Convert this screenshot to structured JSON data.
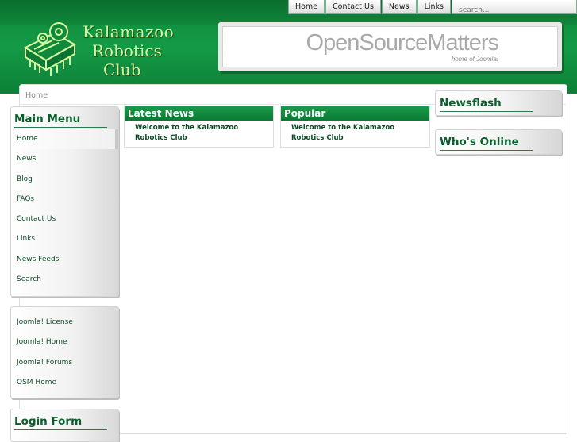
{
  "topnav": {
    "items": [
      "Home",
      "Contact Us",
      "News",
      "Links"
    ],
    "search_placeholder": "search..."
  },
  "header": {
    "club_name": [
      "Kalamazoo",
      "Robotics",
      "Club"
    ],
    "banner_title": "OpenSourceMatters",
    "banner_subtitle": "home of Joomla!"
  },
  "breadcrumb": "Home",
  "main_menu": {
    "title": "Main Menu",
    "items": [
      "Home",
      "News",
      "Blog",
      "FAQs",
      "Contact Us",
      "Links",
      "News Feeds",
      "Search"
    ]
  },
  "other_menu": {
    "items": [
      "Joomla! License",
      "Joomla! Home",
      "Joomla! Forums",
      "OSM Home"
    ]
  },
  "login": {
    "title": "Login Form"
  },
  "latest_news": {
    "title": "Latest News",
    "link": "Welcome to the Kalamazoo Robotics Club"
  },
  "popular": {
    "title": "Popular",
    "link": "Welcome to the Kalamazoo Robotics Club"
  },
  "right_modules": {
    "newsflash": "Newsflash",
    "whos_online": "Who's Online"
  },
  "colors": {
    "header_green": "#149a46",
    "title_green": "#0a5f2a",
    "logo_text": "#d8f6a0"
  }
}
